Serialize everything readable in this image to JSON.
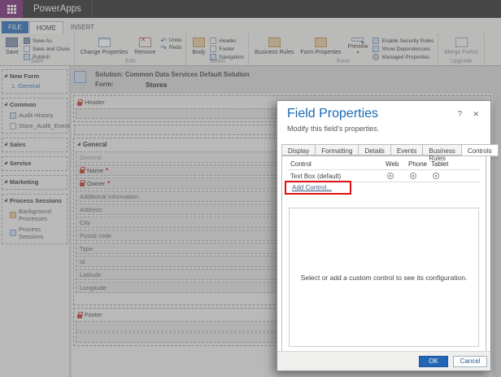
{
  "topbar": {
    "app_name": "PowerApps"
  },
  "icons": {
    "expand_triangle": "◢",
    "undo_arrow": "↶",
    "redo_arrow": "↷",
    "dropdown_caret": "▾",
    "help_glyph": "?",
    "close_glyph": "✕",
    "required_asterisk": "*"
  },
  "ribbon": {
    "tabs": [
      {
        "label": "FILE"
      },
      {
        "label": "HOME"
      },
      {
        "label": "INSERT"
      }
    ],
    "groups": {
      "save": {
        "label": "Save",
        "big_button": "Save",
        "items": [
          "Save As",
          "Save and Close",
          "Publish"
        ]
      },
      "edit": {
        "label": "Edit",
        "big_buttons": [
          "Change Properties",
          "Remove"
        ],
        "items": [
          "Undo",
          "Redo"
        ]
      },
      "select": {
        "label": "Select",
        "big_button": "Body",
        "items": [
          "Header",
          "Footer",
          "Navigation"
        ]
      },
      "form": {
        "label": "Form",
        "big_buttons": [
          "Business Rules",
          "Form Properties",
          "Preview"
        ],
        "items": [
          "Enable Security Roles",
          "Show Dependencies",
          "Managed Properties"
        ]
      },
      "upgrade": {
        "label": "Upgrade",
        "big_button": "Merge Forms"
      }
    }
  },
  "sidebar": {
    "groups": [
      {
        "title": "New Form",
        "items": [
          {
            "label": "1. General"
          }
        ]
      },
      {
        "title": "Common",
        "items": [
          {
            "label": "Audit History"
          },
          {
            "label": "Store_Audit_Events"
          }
        ]
      },
      {
        "title": "Sales",
        "items": []
      },
      {
        "title": "Service",
        "items": []
      },
      {
        "title": "Marketing",
        "items": []
      },
      {
        "title": "Process Sessions",
        "items": [
          {
            "label": "Background Processes"
          },
          {
            "label": "Process Sessions"
          }
        ]
      }
    ]
  },
  "canvas": {
    "solution_label": "Solution: Common Data Services Default Solution",
    "form_label": "Form:",
    "form_name": "Stores",
    "header_section": "Header",
    "general_section": "General",
    "general_subtab": "General",
    "fields": [
      {
        "label": "Name",
        "required": "*",
        "locked": true
      },
      {
        "label": "Owner",
        "required": "*",
        "locked": true
      },
      {
        "label": "Additional information"
      },
      {
        "label": "Address"
      },
      {
        "label": "City"
      },
      {
        "label": "Postal code"
      },
      {
        "label": "Type"
      },
      {
        "label": "Id"
      },
      {
        "label": "Latitude"
      },
      {
        "label": "Longitude"
      }
    ],
    "footer_section": "Footer"
  },
  "dialog": {
    "title": "Field Properties",
    "subtitle": "Modify this field's properties.",
    "tabs": [
      "Display",
      "Formatting",
      "Details",
      "Events",
      "Business Rules",
      "Controls"
    ],
    "active_tab": "Controls",
    "table": {
      "headers": [
        "Control",
        "Web",
        "Phone",
        "Tablet"
      ],
      "rows": [
        {
          "control": "Text Box (default)",
          "web": "selected",
          "phone": "selected",
          "tablet": "selected"
        }
      ]
    },
    "add_control_label": "Add Control...",
    "empty_message": "Select or add a custom control to see its configuration.",
    "ok_label": "OK",
    "cancel_label": "Cancel"
  },
  "colors": {
    "brand_purple": "#742774",
    "title_blue": "#1668b6",
    "ok_blue": "#2265b4",
    "highlight_red": "#e01010",
    "required_red": "#cc1111"
  }
}
